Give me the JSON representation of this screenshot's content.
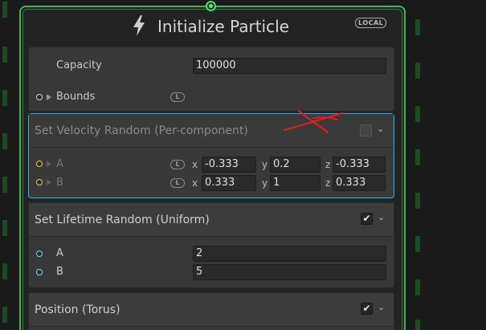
{
  "node": {
    "title": "Initialize Particle",
    "local_badge": "LOCAL",
    "icon": "lightning-bolt-icon",
    "border_color": "#3fb65b"
  },
  "capacity_section": {
    "capacity_label": "Capacity",
    "capacity_value": "100000",
    "bounds_label": "Bounds",
    "bounds_badge": "L"
  },
  "velocity_block": {
    "title": "Set Velocity Random (Per-component)",
    "enabled": false,
    "selected_border_color": "#3da9e9",
    "annotation": "red-x-mark",
    "rows": [
      {
        "label": "A",
        "badge": "L",
        "x_axis": "x",
        "x": "-0.333",
        "y_axis": "y",
        "y": "0.2",
        "z_axis": "z",
        "z": "-0.333"
      },
      {
        "label": "B",
        "badge": "L",
        "x_axis": "x",
        "x": "0.333",
        "y_axis": "y",
        "y": "1",
        "z_axis": "z",
        "z": "0.333"
      }
    ]
  },
  "lifetime_block": {
    "title": "Set Lifetime Random (Uniform)",
    "enabled": true,
    "rows": [
      {
        "label": "A",
        "value": "2"
      },
      {
        "label": "B",
        "value": "5"
      }
    ]
  },
  "position_block": {
    "title": "Position (Torus)",
    "enabled": true
  },
  "icons": {
    "checkmark": "✔",
    "chevron": "⌄"
  }
}
